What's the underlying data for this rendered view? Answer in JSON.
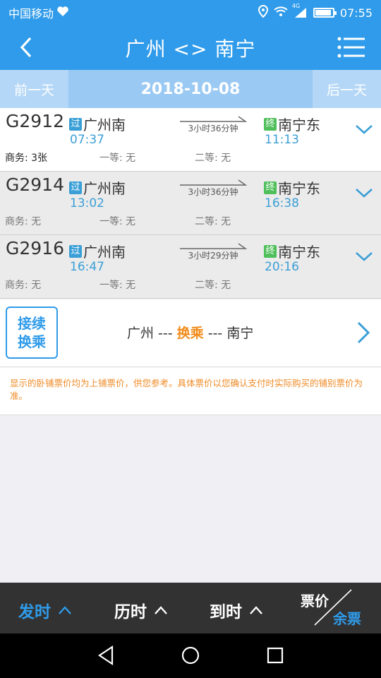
{
  "status_bar": {
    "carrier": "中国移动",
    "network": "4G",
    "time": "07:55"
  },
  "header": {
    "title": "广州 <> 南宁"
  },
  "date_bar": {
    "prev_label": "前一天",
    "date": "2018-10-08",
    "next_label": "后一天"
  },
  "trains": [
    {
      "number": "G2912",
      "from_badge": "过",
      "from": "广州南",
      "depart": "07:37",
      "duration": "3小时36分钟",
      "to_badge": "终",
      "to": "南宁东",
      "arrive": "11:13",
      "seats": [
        "商务: 3张",
        "一等: 无",
        "二等: 无"
      ]
    },
    {
      "number": "G2914",
      "from_badge": "过",
      "from": "广州南",
      "depart": "13:02",
      "duration": "3小时36分钟",
      "to_badge": "终",
      "to": "南宁东",
      "arrive": "16:38",
      "seats": [
        "商务: 无",
        "一等: 无",
        "二等: 无"
      ]
    },
    {
      "number": "G2916",
      "from_badge": "过",
      "from": "广州南",
      "depart": "16:47",
      "duration": "3小时29分钟",
      "to_badge": "终",
      "to": "南宁东",
      "arrive": "20:16",
      "seats": [
        "商务: 无",
        "一等: 无",
        "二等: 无"
      ]
    }
  ],
  "transfer": {
    "box_line1": "接续",
    "box_line2": "换乘",
    "from": "广州 ---",
    "via": "换乘",
    "to": "--- 南宁"
  },
  "note": "显示的卧铺票价均为上铺票价，供您参考。具体票价以您确认支付时实际购买的铺别票价为准。",
  "sort_bar": {
    "depart": "发时",
    "duration": "历时",
    "arrive": "到时",
    "price": "票价",
    "remaining": "余票"
  },
  "colors": {
    "primary": "#2f9bea",
    "accent": "#f08c1a",
    "pass_badge": "#3a9fd6",
    "end_badge": "#4fbf5a"
  }
}
